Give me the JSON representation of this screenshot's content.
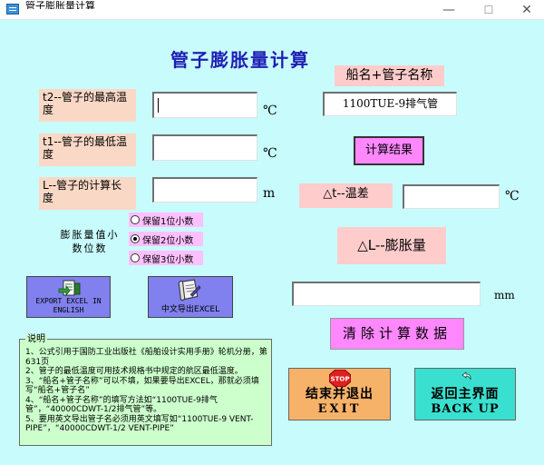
{
  "window": {
    "title": "管子膨胀量计算",
    "minimize_icon": "minimize-icon",
    "maximize_icon": "maximize-icon",
    "close_icon": "close-icon"
  },
  "heading": "管子膨胀量计算",
  "inputs": {
    "t2": {
      "label": "t2--管子的最高温度",
      "value": "",
      "unit": "℃"
    },
    "t1": {
      "label": "t1--管子的最低温度",
      "value": "",
      "unit": "℃"
    },
    "length": {
      "label": "L--管子的计算长度",
      "value": "",
      "unit": "m"
    }
  },
  "ship": {
    "label": "船名+管子名称",
    "value": "1100TUE-9排气管"
  },
  "calc_button": "计算结果",
  "delta_t": {
    "label": "△t--温差",
    "value": "",
    "unit": "℃"
  },
  "delta_l": {
    "label": "△L--膨胀量",
    "value": "",
    "unit": "mm"
  },
  "decimals": {
    "title": "膨胀量值小数位数",
    "options": [
      {
        "label": "保留1位小数",
        "selected": false
      },
      {
        "label": "保留2位小数",
        "selected": true
      },
      {
        "label": "保留3位小数",
        "selected": false
      }
    ]
  },
  "export_en": {
    "label": "EXPORT EXCEL IN ENGLISH",
    "icon": "excel-export-icon"
  },
  "export_cn": {
    "label": "中文导出EXCEL",
    "icon": "document-scroll-icon"
  },
  "clear_button": "清除计算数据",
  "notes": {
    "title": "说明",
    "lines": [
      "1、公式引用于国防工业出版社《船舶设计实用手册》轮机分册，第631页",
      "2、管子的最低温度可用技术规格书中规定的航区最低温度。",
      "3、“船名+管子名称”可以不填，如果要导出EXCEL，那就必须填写“船名+管子名”",
      "4、“船名+管子名称”的填写方法如“1100TUE-9排气管”，“40000CDWT-1/2排气管”等。",
      "5、要用英文导出管子名必须用英文填写如“1100TUE-9 VENT-PIPE”，“40000CDWT-1/2 VENT-PIPE”"
    ]
  },
  "exit_button": {
    "line1": "结束并退出",
    "line2": "EXIT",
    "icon": "stop-sign-icon"
  },
  "back_button": {
    "line1": "返回主界面",
    "line2": "BACK UP",
    "icon": "back-arrow-icon"
  },
  "colors": {
    "background": "#c8fcfc",
    "heading": "#1e1eb4",
    "label_bg": "#f9d8c6",
    "pink_button": "#ff88ff",
    "export_button": "#8080ee",
    "exit_button": "#f7b26a",
    "back_button": "#3ae0cf",
    "note_bg": "#ccffcc"
  }
}
